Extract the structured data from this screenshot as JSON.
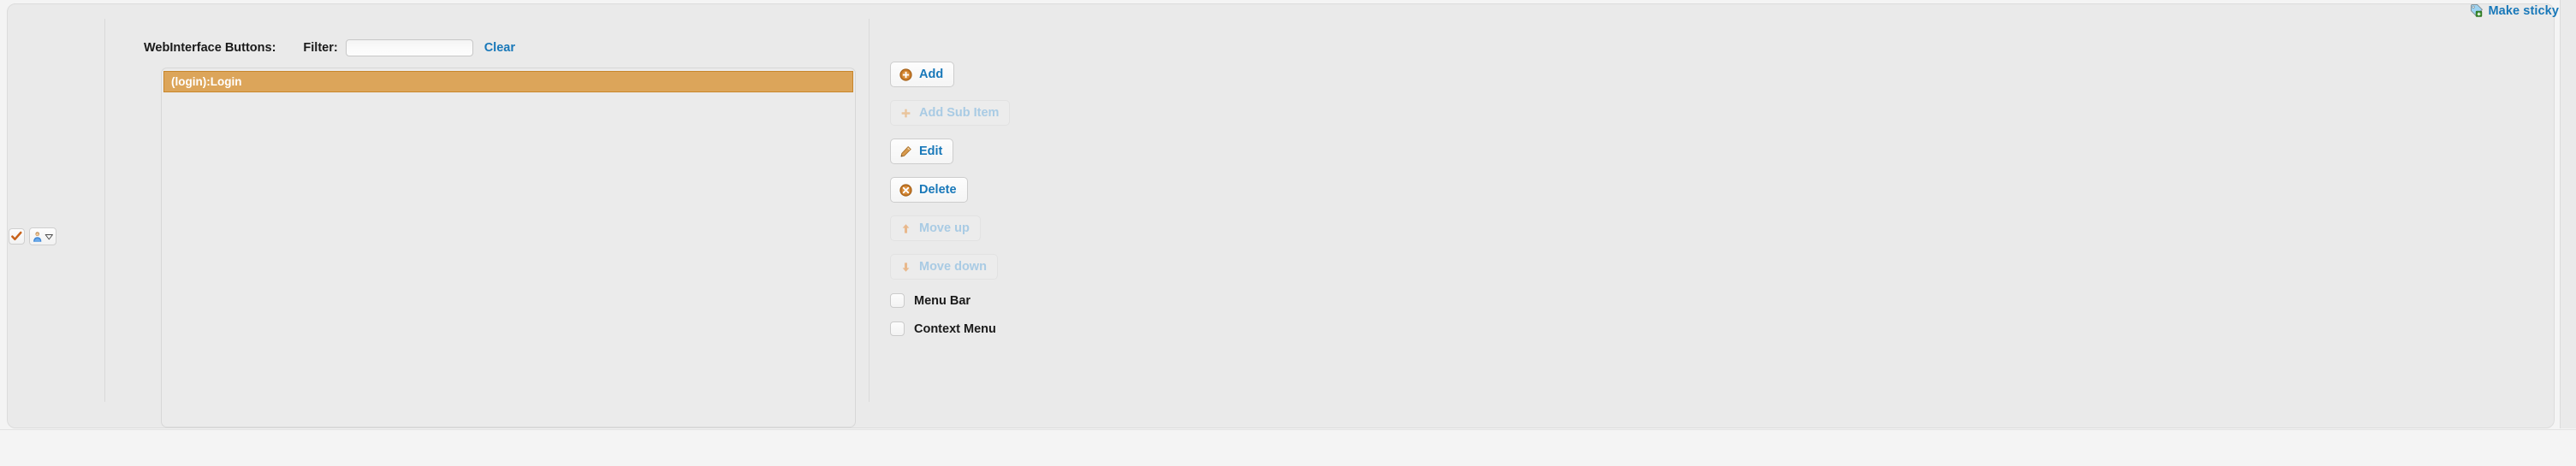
{
  "window": {
    "make_sticky_label": "Make sticky",
    "make_sticky_icon": "tag-plus-icon"
  },
  "left_toolbar": {
    "checkbox_icon": "orange-checkmark-icon",
    "user_button_icon": "user-icon",
    "user_button_caret": "chevron-down-icon"
  },
  "header": {
    "panel_label": "WebInterface Buttons:",
    "filter_label": "Filter:",
    "filter_value": "",
    "filter_placeholder": "",
    "clear_label": "Clear"
  },
  "list": {
    "items": [
      {
        "label": "(login):Login",
        "selected": true
      }
    ],
    "selected_bg": "#dca55a",
    "selected_border": "#c8862b"
  },
  "actions": [
    {
      "label": "Add",
      "icon": "plus-circle-icon",
      "enabled": true
    },
    {
      "label": "Add Sub Item",
      "icon": "plus-icon",
      "enabled": false
    },
    {
      "label": "Edit",
      "icon": "pencil-icon",
      "enabled": true
    },
    {
      "label": "Delete",
      "icon": "x-circle-icon",
      "enabled": true
    },
    {
      "label": "Move up",
      "icon": "arrow-up-icon",
      "enabled": false
    },
    {
      "label": "Move down",
      "icon": "arrow-down-icon",
      "enabled": false
    }
  ],
  "checkboxes": [
    {
      "label": "Menu Bar",
      "checked": false
    },
    {
      "label": "Context Menu",
      "checked": false
    }
  ],
  "colors": {
    "accent_blue": "#1878b9",
    "accent_orange": "#c8761e",
    "panel_bg": "#eaeaea",
    "page_bg": "#f4f4f4"
  }
}
